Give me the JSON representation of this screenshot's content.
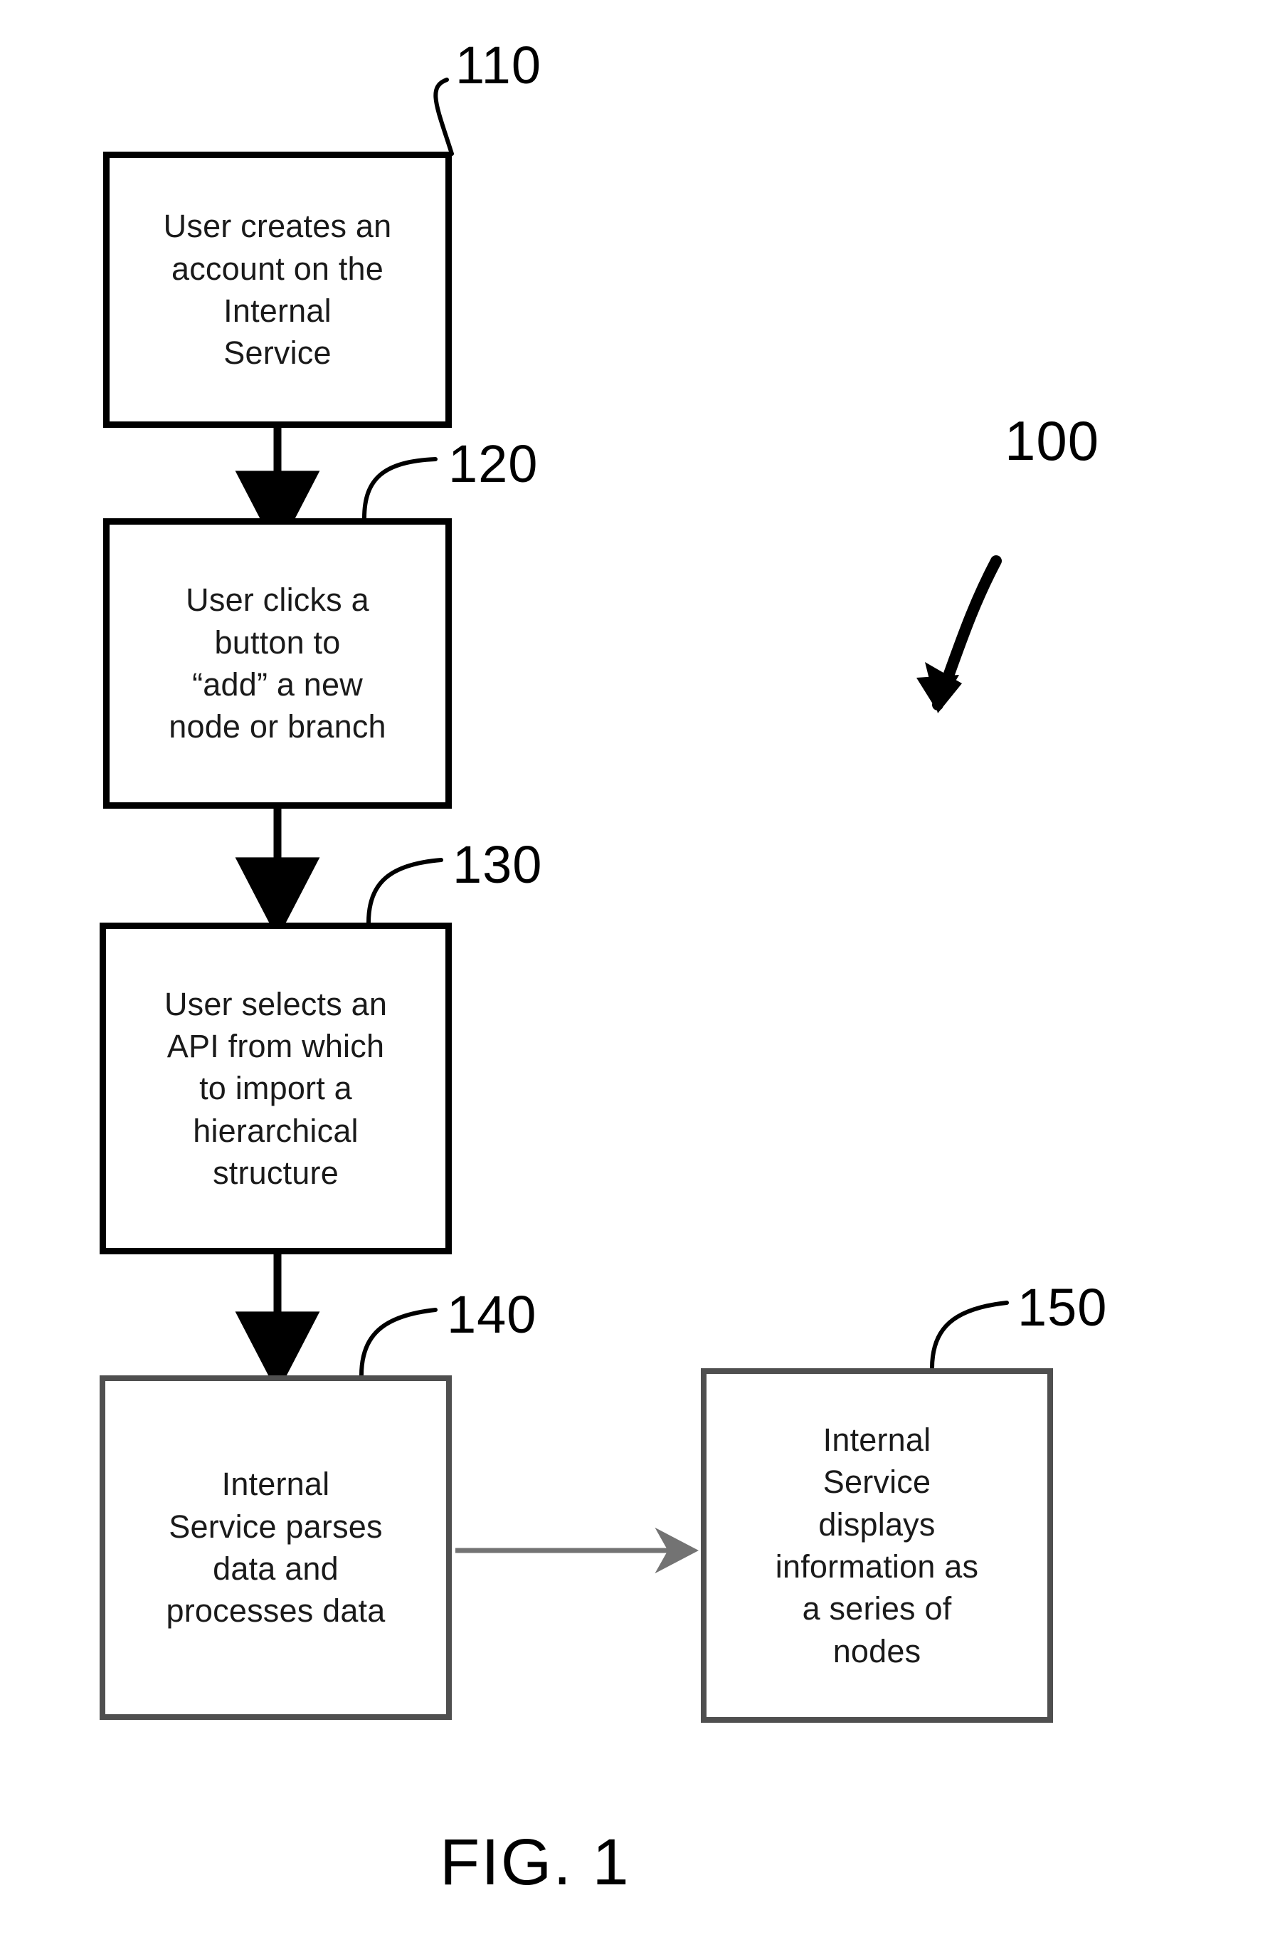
{
  "figure": {
    "caption": "FIG. 1",
    "system_numeral": "100",
    "background_color": "#ffffff",
    "ink_color": "#000000",
    "secondary_ink_color": "#4f4f4f"
  },
  "nodes": [
    {
      "id": "110",
      "numeral": "110",
      "text": "User creates an\naccount on the\nInternal\nService",
      "border_style": "solid-black",
      "border_color": "#000000"
    },
    {
      "id": "120",
      "numeral": "120",
      "text": "User clicks a\nbutton to\n“add” a new\nnode or branch",
      "border_style": "solid-black",
      "border_color": "#000000"
    },
    {
      "id": "130",
      "numeral": "130",
      "text": "User selects an\nAPI from which\nto import a\nhierarchical\nstructure",
      "border_style": "solid-black",
      "border_color": "#000000"
    },
    {
      "id": "140",
      "numeral": "140",
      "text": "Internal\nService parses\ndata and\nprocesses data",
      "border_style": "solid-grey",
      "border_color": "#4f4f4f"
    },
    {
      "id": "150",
      "numeral": "150",
      "text": "Internal\nService\ndisplays\ninformation as\na series of\nnodes",
      "border_style": "solid-grey",
      "border_color": "#4f4f4f"
    }
  ],
  "connectors": [
    {
      "from": "110",
      "to": "120",
      "direction": "down",
      "color": "#000000",
      "style": "solid-filled-arrowhead"
    },
    {
      "from": "120",
      "to": "130",
      "direction": "down",
      "color": "#000000",
      "style": "solid-filled-arrowhead"
    },
    {
      "from": "130",
      "to": "140",
      "direction": "down",
      "color": "#000000",
      "style": "solid-filled-arrowhead"
    },
    {
      "from": "140",
      "to": "150",
      "direction": "right",
      "color": "#737373",
      "style": "thin-open-arrowhead"
    }
  ]
}
